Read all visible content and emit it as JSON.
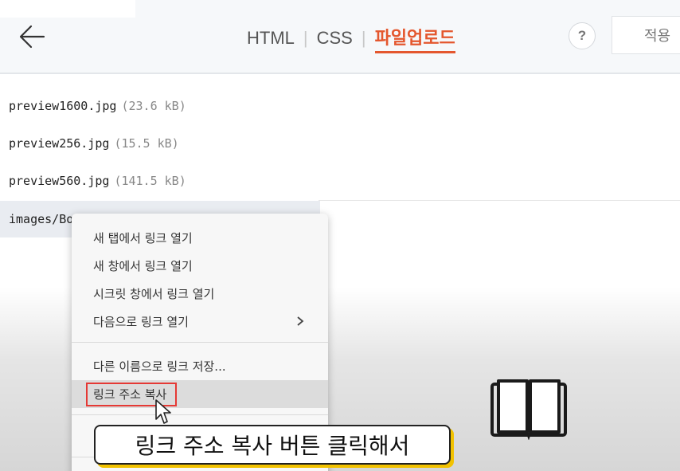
{
  "header": {
    "tabs": [
      {
        "label": "HTML"
      },
      {
        "label": "CSS"
      },
      {
        "label": "파일업로드",
        "active": true
      }
    ],
    "help_label": "?",
    "apply_label": "적용"
  },
  "files": [
    {
      "name": "preview1600.jpg",
      "size": "(23.6 kB)"
    },
    {
      "name": "preview256.jpg",
      "size": "(15.5 kB)"
    },
    {
      "name": "preview560.jpg",
      "size": "(141.5 kB)"
    },
    {
      "name": "images/Bo",
      "size": ""
    }
  ],
  "context_menu": {
    "items": [
      {
        "label": "새 탭에서 링크 열기"
      },
      {
        "label": "새 창에서 링크 열기"
      },
      {
        "label": "시크릿 창에서 링크 열기"
      },
      {
        "label": "다음으로 링크 열기",
        "has_submenu": true
      },
      {
        "label": "다른 이름으로 링크 저장..."
      },
      {
        "label": "링크 주소 복사",
        "hovered": true
      }
    ]
  },
  "caption": "링크 주소 복사 버튼 클릭해서",
  "colors": {
    "accent": "#e4572e",
    "highlight_box": "#e53935",
    "caption_shadow": "#f2c200"
  },
  "icons": [
    "back-arrow-icon",
    "help-icon",
    "chevron-right-icon",
    "mouse-cursor-icon",
    "book-icon"
  ]
}
